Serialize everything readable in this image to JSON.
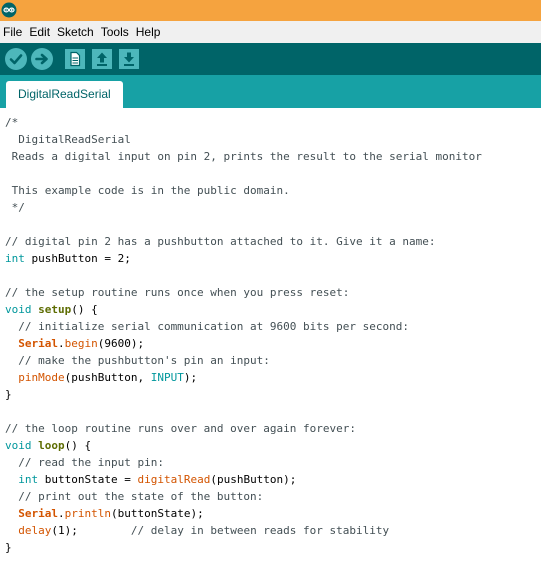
{
  "window": {
    "app_icon": "arduino-logo-icon",
    "accent_color": "#f5a33f",
    "toolbar_color": "#006468",
    "tabbar_color": "#17a1a5"
  },
  "menu": {
    "items": [
      "File",
      "Edit",
      "Sketch",
      "Tools",
      "Help"
    ]
  },
  "toolbar": {
    "buttons": [
      "verify-icon",
      "upload-icon",
      "new-icon",
      "open-icon",
      "save-icon"
    ]
  },
  "tabs": [
    {
      "label": "DigitalReadSerial",
      "active": true
    }
  ],
  "syntax_colors": {
    "comment": "#434f54",
    "type": "#00979c",
    "keyword": "#5e6d03",
    "function": "#d35400"
  },
  "editor": {
    "lines": [
      [
        {
          "t": "/*",
          "c": "comment"
        }
      ],
      [
        {
          "t": "  DigitalReadSerial",
          "c": "comment"
        }
      ],
      [
        {
          "t": " Reads a digital input on pin 2, prints the result to the serial monitor",
          "c": "comment"
        }
      ],
      [],
      [
        {
          "t": " This example code is in the public domain.",
          "c": "comment"
        }
      ],
      [
        {
          "t": " */",
          "c": "comment"
        }
      ],
      [],
      [
        {
          "t": "// digital pin 2 has a pushbutton attached to it. Give it a name:",
          "c": "comment"
        }
      ],
      [
        {
          "t": "int",
          "c": "type"
        },
        {
          "t": " pushButton = 2;",
          "c": ""
        }
      ],
      [],
      [
        {
          "t": "// the setup routine runs once when you press reset:",
          "c": "comment"
        }
      ],
      [
        {
          "t": "void",
          "c": "type"
        },
        {
          "t": " ",
          "c": ""
        },
        {
          "t": "setup",
          "c": "struct"
        },
        {
          "t": "() {",
          "c": ""
        }
      ],
      [
        {
          "t": "  // initialize serial communication at 9600 bits per second:",
          "c": "comment"
        }
      ],
      [
        {
          "t": "  ",
          "c": ""
        },
        {
          "t": "Serial",
          "c": "class"
        },
        {
          "t": ".",
          "c": ""
        },
        {
          "t": "begin",
          "c": "func"
        },
        {
          "t": "(9600);",
          "c": ""
        }
      ],
      [
        {
          "t": "  // make the pushbutton's pin an input:",
          "c": "comment"
        }
      ],
      [
        {
          "t": "  ",
          "c": ""
        },
        {
          "t": "pinMode",
          "c": "func"
        },
        {
          "t": "(pushButton, ",
          "c": ""
        },
        {
          "t": "INPUT",
          "c": "const"
        },
        {
          "t": ");",
          "c": ""
        }
      ],
      [
        {
          "t": "}",
          "c": ""
        }
      ],
      [],
      [
        {
          "t": "// the loop routine runs over and over again forever:",
          "c": "comment"
        }
      ],
      [
        {
          "t": "void",
          "c": "type"
        },
        {
          "t": " ",
          "c": ""
        },
        {
          "t": "loop",
          "c": "struct"
        },
        {
          "t": "() {",
          "c": ""
        }
      ],
      [
        {
          "t": "  // read the input pin:",
          "c": "comment"
        }
      ],
      [
        {
          "t": "  ",
          "c": ""
        },
        {
          "t": "int",
          "c": "type"
        },
        {
          "t": " buttonState = ",
          "c": ""
        },
        {
          "t": "digitalRead",
          "c": "func"
        },
        {
          "t": "(pushButton);",
          "c": ""
        }
      ],
      [
        {
          "t": "  // print out the state of the button:",
          "c": "comment"
        }
      ],
      [
        {
          "t": "  ",
          "c": ""
        },
        {
          "t": "Serial",
          "c": "class"
        },
        {
          "t": ".",
          "c": ""
        },
        {
          "t": "println",
          "c": "func"
        },
        {
          "t": "(buttonState);",
          "c": ""
        }
      ],
      [
        {
          "t": "  ",
          "c": ""
        },
        {
          "t": "delay",
          "c": "func"
        },
        {
          "t": "(1);        ",
          "c": ""
        },
        {
          "t": "// delay in between reads for stability",
          "c": "comment"
        }
      ],
      [
        {
          "t": "}",
          "c": ""
        }
      ]
    ]
  }
}
